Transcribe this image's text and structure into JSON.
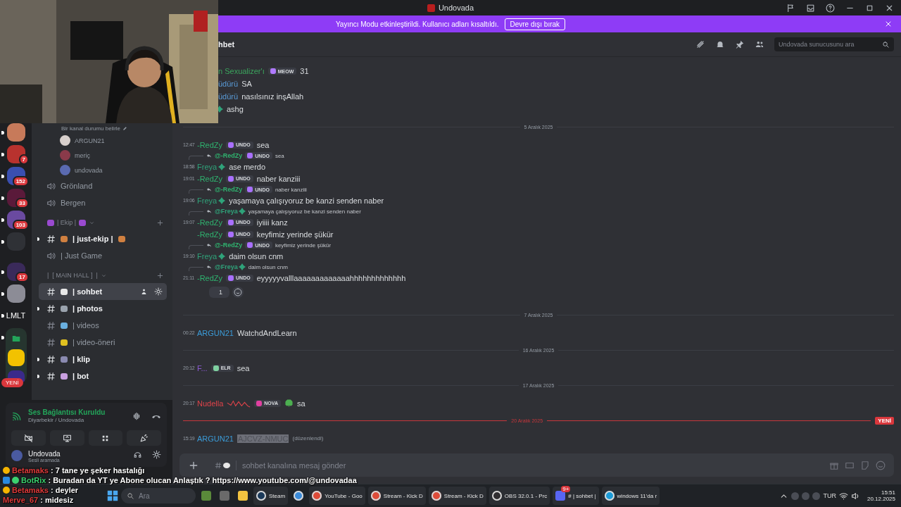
{
  "window": {
    "title": "Undovada"
  },
  "banner": {
    "text": "Yayıncı Modu etkinleştirildi. Kullanıcı adları kısaltıldı.",
    "button": "Devre dışı bırak"
  },
  "servers": [
    {
      "kind": "avatar",
      "color": "#c77a5a",
      "unread": true
    },
    {
      "kind": "avatar",
      "color": "#b8322e",
      "badge": "7",
      "unread": true
    },
    {
      "kind": "avatar",
      "color": "#3a4fb0",
      "badge": "152",
      "unread": true
    },
    {
      "kind": "avatar",
      "color": "#5a1a3a",
      "badge": "33",
      "unread": true
    },
    {
      "kind": "avatar",
      "color": "#6a4aa0",
      "badge": "103",
      "unread": true
    },
    {
      "kind": "avatar",
      "color": "#2f3136",
      "unread": true
    },
    {
      "kind": "avatar",
      "color": "#3a2a5a",
      "badge": "17",
      "unread": true
    },
    {
      "kind": "avatar",
      "color": "#8c8c96",
      "unread": true
    },
    {
      "kind": "text",
      "label": "LMLT",
      "unread": true
    },
    {
      "kind": "folder",
      "badge": "YENİ",
      "unread": true,
      "children": [
        {
          "kind": "file"
        },
        {
          "kind": "avatar",
          "color": "#f2c200"
        },
        {
          "kind": "avatar",
          "color": "#3a2a8a"
        }
      ]
    }
  ],
  "channel_list": {
    "status_prompt": "Bir kanal durumu belirle",
    "voice_members": [
      {
        "name": "ARGUN21",
        "color": "#d8d0cc"
      },
      {
        "name": "meriç",
        "color": "#8a3a4a"
      },
      {
        "name": "undovada",
        "color": "#5a6ab0"
      }
    ],
    "channels": [
      {
        "kind": "voice",
        "name": "Grönland",
        "selected": false,
        "unread": false
      },
      {
        "kind": "voice",
        "name": "Bergen",
        "selected": false,
        "unread": false
      },
      {
        "kind": "category",
        "name": "| Ekip |",
        "color": "#9a4ad0",
        "emoji_after": true
      },
      {
        "kind": "text",
        "name": "| just-ekip |",
        "color": "#d08040",
        "emoji_after": true,
        "selected": false,
        "unread": true
      },
      {
        "kind": "voice",
        "name": "| Just Game",
        "selected": false,
        "unread": false
      },
      {
        "kind": "category",
        "name": "|  [ MAIN HALL ]  |"
      },
      {
        "kind": "text",
        "name": "| sohbet",
        "color": "#e8e8e8",
        "selected": true,
        "unread": false
      },
      {
        "kind": "text",
        "name": "| photos",
        "color": "#9aa3ad",
        "selected": false,
        "unread": true
      },
      {
        "kind": "text",
        "name": "| videos",
        "color": "#6ab0e0",
        "selected": false,
        "unread": false
      },
      {
        "kind": "text",
        "name": "| video-öneri",
        "color": "#e0c020",
        "selected": false,
        "unread": false
      },
      {
        "kind": "text",
        "name": "| klip",
        "color": "#8a8ab0",
        "selected": false,
        "unread": true
      },
      {
        "kind": "text",
        "name": "| bot",
        "color": "#c9a0e0",
        "selected": false,
        "unread": true
      }
    ]
  },
  "voice_panel": {
    "status": "Ses Bağlantısı Kuruldu",
    "location": "Diyarbekir / Undovada"
  },
  "user_panel": {
    "name": "Undovada",
    "status": "Sesli aramada"
  },
  "channel_header": {
    "title": "hbet",
    "search": {
      "placeholder": "Undovada sunucusunu ara"
    }
  },
  "messages": [
    {
      "kind": "message",
      "clipped": true,
      "author": "n Sexualizer'ı",
      "color": "#3ba55d",
      "tag": {
        "text": "MEOW",
        "color": "#b07aff"
      },
      "text": "31"
    },
    {
      "kind": "message",
      "clipped": true,
      "author": "üdürü",
      "color": "#5a9bd8",
      "text": "SA"
    },
    {
      "kind": "message",
      "clipped": true,
      "author": "üdürü",
      "color": "#5a9bd8",
      "text": "nasılsınız inşAllah"
    },
    {
      "kind": "message",
      "clipped": true,
      "name_icon": true,
      "color": "#2fa37a",
      "text": "ashg"
    },
    {
      "kind": "date",
      "text": "5 Aralık 2025",
      "new": false
    },
    {
      "kind": "message",
      "time": "12:47",
      "author": "-RedZy",
      "color": "#2fb36f",
      "tag": {
        "text": "UNDO",
        "color": "#a970ff"
      },
      "text": "sea"
    },
    {
      "kind": "message",
      "time": "18:58",
      "author": "Freya",
      "name_icon": true,
      "color": "#2fa37a",
      "text": "ase merdo",
      "reply": {
        "author": "@-RedZy",
        "color": "#2fb36f",
        "tag": {
          "text": "UNDO",
          "color": "#a970ff"
        },
        "text": "sea"
      }
    },
    {
      "kind": "message",
      "time": "19:01",
      "author": "-RedZy",
      "color": "#2fb36f",
      "tag": {
        "text": "UNDO",
        "color": "#a970ff"
      },
      "text": "naber kanziii"
    },
    {
      "kind": "message",
      "time": "19:06",
      "author": "Freya",
      "name_icon": true,
      "color": "#2fa37a",
      "text": "yaşamaya çalışıyoruz be kanzi senden naber",
      "reply": {
        "author": "@-RedZy",
        "color": "#2fb36f",
        "tag": {
          "text": "UNDO",
          "color": "#a970ff"
        },
        "text": "naber kanziii"
      }
    },
    {
      "kind": "message",
      "time": "19:07",
      "author": "-RedZy",
      "color": "#2fb36f",
      "tag": {
        "text": "UNDO",
        "color": "#a970ff"
      },
      "text": "iyiiii kanz",
      "reply": {
        "author": "@Freya",
        "name_icon": true,
        "color": "#2fa37a",
        "text": "yaşamaya çalışıyoruz be kanzi senden naber"
      }
    },
    {
      "kind": "message",
      "author": "-RedZy",
      "color": "#2fb36f",
      "tag": {
        "text": "UNDO",
        "color": "#a970ff"
      },
      "text": "keyfimiz yerinde şükür"
    },
    {
      "kind": "message",
      "time": "19:10",
      "author": "Freya",
      "name_icon": true,
      "color": "#2fa37a",
      "text": "daim olsun cnm",
      "reply": {
        "author": "@-RedZy",
        "color": "#2fb36f",
        "tag": {
          "text": "UNDO",
          "color": "#a970ff"
        },
        "text": "keyfimiz yerinde şükür"
      }
    },
    {
      "kind": "message",
      "time": "21:11",
      "author": "-RedZy",
      "color": "#2fb36f",
      "tag": {
        "text": "UNDO",
        "color": "#a970ff"
      },
      "text": "eyyyyyvalllaaaaaaaaaaaaahhhhhhhhhhhhh",
      "reply": {
        "author": "@Freya",
        "name_icon": true,
        "color": "#2fa37a",
        "text": "daim olsun cnm"
      }
    },
    {
      "kind": "reactions",
      "count": "1"
    },
    {
      "kind": "date",
      "text": "7 Aralık 2025",
      "new": false
    },
    {
      "kind": "message",
      "time": "00:22",
      "author": "ARGUN21",
      "color": "#3b9cd9",
      "text": "WatchdAndLearn"
    },
    {
      "kind": "date",
      "text": "16 Aralık 2025",
      "new": false
    },
    {
      "kind": "message",
      "time": "20:12",
      "author": "F...",
      "color": "#8e5bd6",
      "tag": {
        "text": "ELR",
        "color": "#7fd0a0"
      },
      "text": "sea"
    },
    {
      "kind": "date",
      "text": "17 Aralık 2025",
      "new": false
    },
    {
      "kind": "message",
      "time": "20:17",
      "author": "Nudella",
      "color": "#e0434a",
      "decoration": true,
      "tag": {
        "text": "NOVA",
        "color": "#e040a0"
      },
      "emoji": true,
      "text": "sa"
    },
    {
      "kind": "date",
      "text": "20 Aralık 2025",
      "new": true,
      "badge": "YENİ"
    },
    {
      "kind": "message",
      "time": "15:19",
      "author": "ARGUN21",
      "color": "#3b9cd9",
      "text": "AJCVZ-NMUC",
      "highlight": true,
      "edited": "(düzenlendi)"
    }
  ],
  "composer": {
    "placeholder": "sohbet kanalına mesaj gönder"
  },
  "stream_chat": [
    {
      "author": "Betamaks",
      "color": "#e03a3a",
      "badges": [
        {
          "color": "#f5b400"
        }
      ],
      "text": ": 7 tane ye şeker hastalığı"
    },
    {
      "author": "BotRix",
      "color": "#3bd16f",
      "badges": [
        {
          "color": "#2a8ae0"
        },
        {
          "color": "#3bd16f"
        }
      ],
      "text": ": Buradan da YT ye Abone olucan Anlaştık ? https://www.youtube.com/@undovadaa"
    },
    {
      "author": "Betamaks",
      "color": "#e03a3a",
      "badges": [
        {
          "color": "#f5b400"
        }
      ],
      "text": ": deyler"
    },
    {
      "author": "Merve_67",
      "color": "#e03a3a",
      "text": ": midesiz"
    }
  ],
  "taskbar": {
    "search": {
      "placeholder": "Ara"
    },
    "apps": [
      {
        "kind": "widget"
      },
      {
        "kind": "window"
      },
      {
        "kind": "folder"
      },
      {
        "kind": "steam",
        "label": "Steam"
      },
      {
        "kind": "globe"
      },
      {
        "kind": "chrome",
        "label": "YouTube - Goo"
      },
      {
        "kind": "chrome",
        "label": "Stream - Kick D"
      },
      {
        "kind": "chrome",
        "label": "Stream - Kick D"
      },
      {
        "kind": "obs",
        "label": "OBS 32.0.1 - Prc"
      },
      {
        "kind": "discord",
        "label": "# | sohbet |",
        "badge": "9+"
      },
      {
        "kind": "edge",
        "label": "windows 11'da r"
      }
    ],
    "tray": {
      "language": "TUR",
      "time": "15:51",
      "date": "20.12.2025"
    }
  }
}
